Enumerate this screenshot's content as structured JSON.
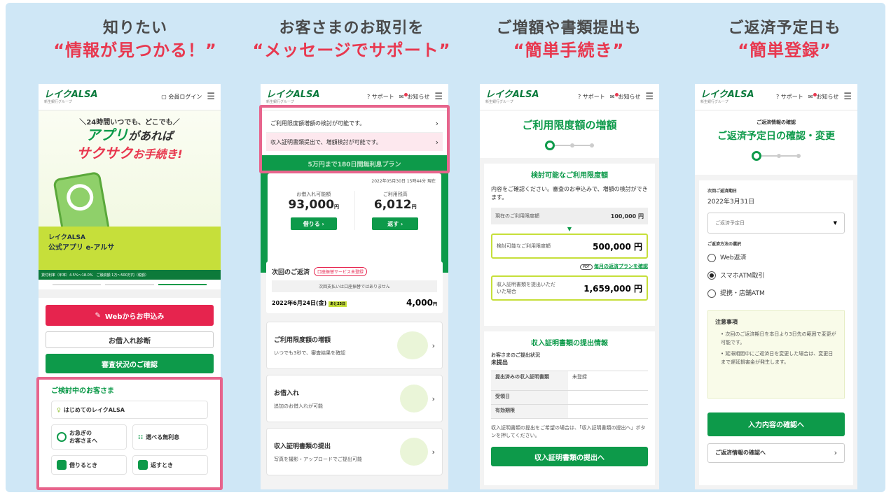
{
  "headings": [
    {
      "line1": "知りたい",
      "line2": "“情報が見つかる！”"
    },
    {
      "line1": "お客さまのお取引を",
      "line2": "“メッセージでサポート”"
    },
    {
      "line1": "ご増額や書類提出も",
      "line2": "“簡単手続き”"
    },
    {
      "line1": "ご返済予定日も",
      "line2": "“簡単登録”"
    }
  ],
  "brand": {
    "logo": "レイクALSA",
    "sub": "新生銀行グループ"
  },
  "nav": {
    "login": "会員ログイン",
    "support": "サポート",
    "notice": "お知らせ"
  },
  "p1": {
    "banner_l1": "＼24時間いつでも、どこでも／",
    "banner_l2a": "アプリ",
    "banner_l2b": "があれば",
    "banner_l3a": "サクサク",
    "banner_l3b": "お手続き!",
    "app_name": "レイクALSA",
    "app_sub": "公式アプリ e-アルサ",
    "rate": "貸付利率（年率）4.5%〜18.0%　ご融資額 1万〜500万円（税額）",
    "btn_apply": "Webからお申込み",
    "btn_diag": "お借入れ診断",
    "btn_status": "審査状況のご確認",
    "consider_title": "ご検討中のお客さま",
    "first": "はじめてのレイクALSA",
    "hurry1": "お急ぎの",
    "hurry2": "お客さまへ",
    "free": "選べる無利息",
    "borrow": "借りるとき",
    "repay": "返すとき"
  },
  "p2": {
    "msg1": "ご利用限度額増額の検討が可能です。",
    "msg2": "収入証明書類提出で、増額検討が可能です。",
    "promo": "5万円まで180日間無利息プラン",
    "timestamp": "2022年05月30日 15時44分 現在",
    "avail_label": "お借入れ可能額",
    "avail_val": "93,000",
    "bal_label": "ご利用残高",
    "bal_val": "6,012",
    "yen": "円",
    "borrow_btn": "借りる",
    "repay_btn": "返す",
    "next_title": "次回のご返済",
    "debit_badge": "口座振替サービス未登録",
    "next_note": "次回支払いは口座振替ではありません",
    "next_date": "2022年6月24日(金)",
    "days_badge": "あと25日",
    "next_amt": "4,000",
    "c1_title": "ご利用限度額の増額",
    "c1_desc": "いつでも3秒で、審査結果を確認",
    "c2_title": "お借入れ",
    "c2_desc": "追加のお借入れが可能",
    "c3_title": "収入証明書類の提出",
    "c3_desc": "写真を撮影・アップロードでご提出可能"
  },
  "p3": {
    "title": "ご利用限度額の増額",
    "box_title": "検討可能なご利用限度額",
    "intro": "内容をご確認ください。審査のお申込みで、増額の検討ができます。",
    "cur_label": "現在のご利用限度額",
    "cur_val": "100,000 円",
    "cand_label": "検討可能なご利用限度額",
    "cand_val": "500,000 円",
    "pdf": "PDF",
    "plan_link": "毎月の返済プランを確認",
    "doc_label": "収入証明書類を提出いただいた場合",
    "doc_val": "1,659,000 円",
    "info_title": "収入証明書類の提出情報",
    "status_label": "お客さまのご提出状況",
    "status_val": "未提出",
    "t_r1": "提出済みの収入証明書類",
    "t_r1v": "未登録",
    "t_r2": "受領日",
    "t_r3": "有効期限",
    "note": "収入証明書類の提出をご希望の場合は、「収入証明書類の提出へ」ボタンを押してください。",
    "btn": "収入証明書類の提出へ"
  },
  "p4": {
    "small_title": "ご返済情報の確認",
    "title": "ご返済予定日の確認・変更",
    "next_label": "次回ご返済期日",
    "next_val": "2022年3月31日",
    "select_placeholder": "ご返済予定日",
    "method_label": "ご返済方法の選択",
    "opt1": "Web返済",
    "opt2": "スマホATM取引",
    "opt3": "提携・店舗ATM",
    "notice_title": "注意事項",
    "notice1": "次回のご返済期日を本日より3日先の範囲で変更が可能です。",
    "notice2": "延滞期間中にご返済日を変更した場合は、変更日まで遅延損害金が発生します。",
    "btn_confirm": "入力内容の確認へ",
    "btn_info": "ご返済情報の確認へ"
  },
  "colors": {
    "accent": "#e8384f",
    "green": "#0d9a4a",
    "lime": "#c6df3a",
    "pink_highlight": "#e7648c"
  }
}
